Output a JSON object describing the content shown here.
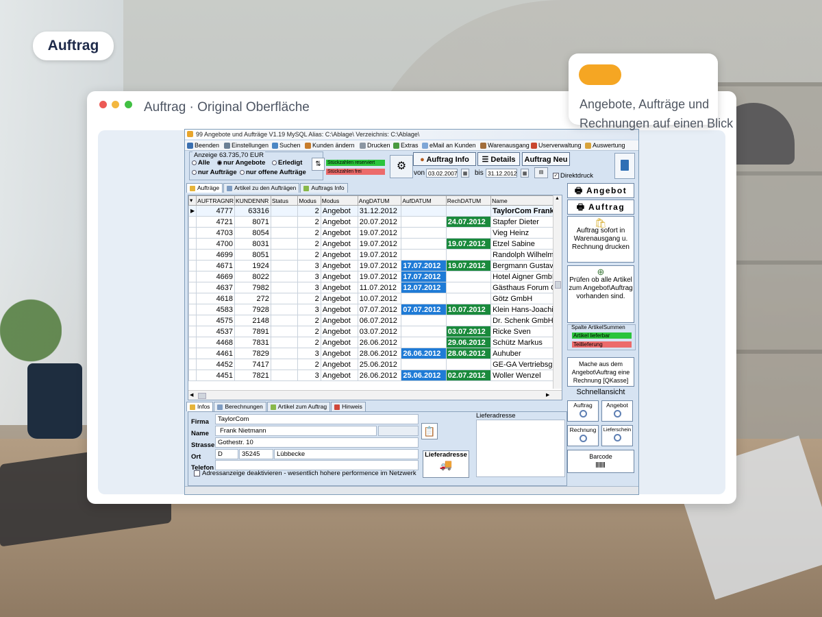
{
  "badge": "Auftrag",
  "info_card": {
    "text": "Angebote, Aufträge und Rechnungen auf einen Blick"
  },
  "frame": {
    "title": "Auftrag · Original Oberfläche"
  },
  "app": {
    "titlebar": "99  Angebote und Aufträge   V1.19 MySQL   Alias:  C:\\Ablage\\   Verzeichnis: C:\\Ablage\\",
    "menu": [
      "Beenden",
      "Einstellungen",
      "Suchen",
      "Kunden ändern",
      "Drucken",
      "Extras",
      "eMail an Kunden",
      "Warenausgang",
      "Userverwaltung",
      "Auswertung"
    ],
    "anzeige": {
      "label": "Anzeige  63.735,70 EUR",
      "options": [
        "Alle",
        "nur Angebote",
        "Erledigt",
        "nur Aufträge",
        "nur offene Aufträge"
      ],
      "selected": "nur Angebote"
    },
    "stueck_reserviert": "Stückzahlen reserviert",
    "stueck_frei": "Stückzahlen frei",
    "btn_info": "Auftrag Info",
    "btn_details": "Details",
    "btn_neu": "Auftrag Neu",
    "von_label": "von",
    "von_date": "03.02.2007",
    "bis_label": "bis",
    "bis_date": "31.12.2012",
    "direktdruck": "Direktdruck",
    "tabs_top": [
      "Aufträge",
      "Artikel zu den Aufträgen",
      "Auftrags Info"
    ],
    "grid": {
      "columns": [
        "AUFTRAGNR",
        "KUNDENNR",
        "Status",
        "Modus",
        "Modus",
        "AngDATUM",
        "AufDATUM",
        "RechDATUM",
        "Name"
      ],
      "rows": [
        [
          "4777",
          "63316",
          "",
          "2",
          "Angebot",
          "31.12.2012",
          "",
          "",
          "TaylorCom  Frank"
        ],
        [
          "4721",
          "8071",
          "",
          "2",
          "Angebot",
          "20.07.2012",
          "",
          "24.07.2012",
          "Stapfer Dieter"
        ],
        [
          "4703",
          "8054",
          "",
          "2",
          "Angebot",
          "19.07.2012",
          "",
          "",
          "Vieg Heinz"
        ],
        [
          "4700",
          "8031",
          "",
          "2",
          "Angebot",
          "19.07.2012",
          "",
          "19.07.2012",
          "Etzel Sabine"
        ],
        [
          "4699",
          "8051",
          "",
          "2",
          "Angebot",
          "19.07.2012",
          "",
          "",
          "Randolph Wilhelm"
        ],
        [
          "4671",
          "1924",
          "",
          "3",
          "Angebot",
          "19.07.2012",
          "17.07.2012",
          "19.07.2012",
          "Bergmann Gustav"
        ],
        [
          "4669",
          "8022",
          "",
          "3",
          "Angebot",
          "19.07.2012",
          "17.07.2012",
          "",
          "Hotel Aigner GmbH"
        ],
        [
          "4637",
          "7982",
          "",
          "3",
          "Angebot",
          "11.07.2012",
          "12.07.2012",
          "",
          "Gästhaus Forum C"
        ],
        [
          "4618",
          "272",
          "",
          "2",
          "Angebot",
          "10.07.2012",
          "",
          "",
          "Götz GmbH"
        ],
        [
          "4583",
          "7928",
          "",
          "3",
          "Angebot",
          "07.07.2012",
          "07.07.2012",
          "10.07.2012",
          "Klein Hans-Joachim"
        ],
        [
          "4575",
          "2148",
          "",
          "2",
          "Angebot",
          "06.07.2012",
          "",
          "",
          "Dr. Schenk GmbH"
        ],
        [
          "4537",
          "7891",
          "",
          "2",
          "Angebot",
          "03.07.2012",
          "",
          "03.07.2012",
          "Ricke Sven"
        ],
        [
          "4468",
          "7831",
          "",
          "2",
          "Angebot",
          "26.06.2012",
          "",
          "29.06.2012",
          "Schütz Markus"
        ],
        [
          "4461",
          "7829",
          "",
          "3",
          "Angebot",
          "28.06.2012",
          "26.06.2012",
          "28.06.2012",
          "Auhuber"
        ],
        [
          "4452",
          "7417",
          "",
          "2",
          "Angebot",
          "25.06.2012",
          "",
          "",
          "GE-GA Vertriebsg"
        ],
        [
          "4451",
          "7821",
          "",
          "3",
          "Angebot",
          "26.06.2012",
          "25.06.2012",
          "02.07.2012",
          "Woller Wenzel"
        ]
      ]
    },
    "tabs_bottom": [
      "Infos",
      "Berechnungen",
      "Artikel zum Auftrag",
      "Hinweis"
    ],
    "infos": {
      "firma_label": "Firma",
      "firma": "TaylorCom",
      "name_label": "Name",
      "name": "Frank Nietmann",
      "strasse_label": "Strasse",
      "strasse": "Gothestr. 10",
      "ort_label": "Ort",
      "land": "D",
      "plz": "35245",
      "ort": "Lübbecke",
      "telefon_label": "Telefon",
      "lieferadresse_btn": "Lieferadresse",
      "lieferadresse_label": "Lieferadresse",
      "deactivate": "Adressanzeige deaktivieren - wesentlich hohere performence im Netzwerk"
    },
    "right": {
      "angebot": "Angebot",
      "auftrag": "Auftrag",
      "auftrag_sofort": "Auftrag sofort in Warenausgang u. Rechnung drucken",
      "pruefen": "Prüfen ob alle Artikel zum Angebot\\Auftrag vorhanden sind.",
      "summen_label": "Spalte ArtikelSummen",
      "lieferbar": "Artikel lieferbar",
      "teillieferung": "Teillieferung",
      "mache": "Mache aus dem Angebot\\Auftrag eine Rechnung [QKasse]",
      "schnellansicht": "Schnellansicht",
      "q_auftrag": "Auftrag",
      "q_angebot": "Angebot",
      "q_rechnung": "Rechnung",
      "q_lieferschein": "Lieferschein",
      "barcode": "Barcode"
    }
  }
}
